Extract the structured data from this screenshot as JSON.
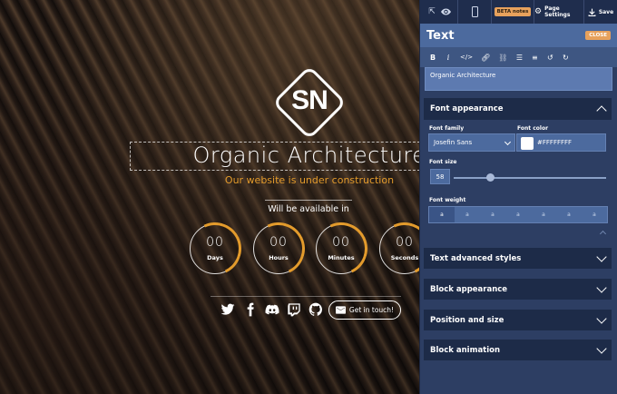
{
  "site": {
    "logo_text": "SN",
    "title": "Organic Architecture",
    "subtitle": "Our website is under construction",
    "available_text": "Will be available in",
    "counters": [
      {
        "value": "00",
        "label": "Days"
      },
      {
        "value": "00",
        "label": "Hours"
      },
      {
        "value": "00",
        "label": "Minutes"
      },
      {
        "value": "00",
        "label": "Seconds"
      }
    ],
    "social_icons": [
      "twitter-icon",
      "facebook-icon",
      "discord-icon",
      "twitch-icon",
      "github-icon"
    ],
    "cta_label": "Get in touch!",
    "accent_color": "#e39b2c"
  },
  "topbar": {
    "beta_label": "BETA notes",
    "page_settings_label": "Page Settings",
    "save_label": "Save"
  },
  "panel": {
    "title": "Text",
    "close_label": "CLOSE",
    "format_buttons": [
      "B",
      "i",
      "</>",
      "link",
      "unlink",
      "bullets",
      "numbers",
      "undo",
      "redo"
    ],
    "text_value": "Organic Architecture",
    "font_appearance": {
      "heading": "Font appearance",
      "family_label": "Font family",
      "family_value": "Josefin Sans",
      "color_label": "Font color",
      "color_value": "#FFFFFFFF",
      "size_label": "Font size",
      "size_value": "58",
      "weight_label": "Font weight",
      "weights": [
        "a",
        "a",
        "a",
        "a",
        "a",
        "a",
        "a"
      ]
    },
    "sections": [
      "Text advanced styles",
      "Block appearance",
      "Position and size",
      "Block animation"
    ]
  }
}
